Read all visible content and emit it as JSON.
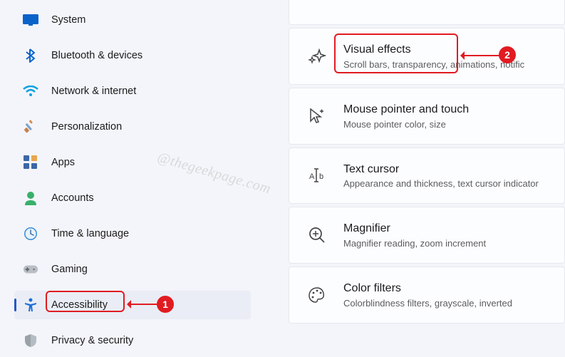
{
  "sidebar": {
    "items": [
      {
        "label": "System",
        "icon": "system-icon",
        "color": "#0a63c9"
      },
      {
        "label": "Bluetooth & devices",
        "icon": "bluetooth-icon",
        "color": "#0a63c9"
      },
      {
        "label": "Network & internet",
        "icon": "wifi-icon",
        "color": "#0aa1e0"
      },
      {
        "label": "Personalization",
        "icon": "paint-icon",
        "color": "#c98048"
      },
      {
        "label": "Apps",
        "icon": "apps-icon",
        "color": "#3b67a6"
      },
      {
        "label": "Accounts",
        "icon": "accounts-icon",
        "color": "#38b06a"
      },
      {
        "label": "Time & language",
        "icon": "clock-icon",
        "color": "#3a8fd6"
      },
      {
        "label": "Gaming",
        "icon": "gaming-icon",
        "color": "#8a8f94"
      },
      {
        "label": "Accessibility",
        "icon": "accessibility-icon",
        "color": "#1e6fd8",
        "selected": true
      },
      {
        "label": "Privacy & security",
        "icon": "shield-icon",
        "color": "#9aa2a9"
      }
    ]
  },
  "main": {
    "items": [
      {
        "title_cut": "",
        "desc_cut": ""
      },
      {
        "title": "Visual effects",
        "desc": "Scroll bars, transparency, animations, notific"
      },
      {
        "title": "Mouse pointer and touch",
        "desc": "Mouse pointer color, size"
      },
      {
        "title": "Text cursor",
        "desc": "Appearance and thickness, text cursor indicator"
      },
      {
        "title": "Magnifier",
        "desc": "Magnifier reading, zoom increment"
      },
      {
        "title": "Color filters",
        "desc": "Colorblindness filters, grayscale, inverted"
      }
    ]
  },
  "annotations": {
    "badge1": "1",
    "badge2": "2"
  },
  "watermark": "@thegeekpage.com"
}
